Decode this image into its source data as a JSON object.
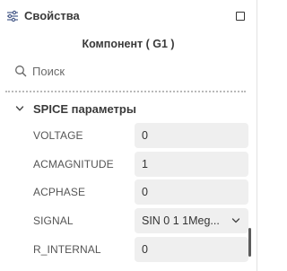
{
  "panel": {
    "title": "Свойства",
    "component_title": "Компонент ( G1 )"
  },
  "search": {
    "placeholder": "Поиск",
    "value": ""
  },
  "section": {
    "title": "SPICE параметры",
    "expanded": true
  },
  "params": [
    {
      "label": "VOLTAGE",
      "value": "0"
    },
    {
      "label": "ACMAGNITUDE",
      "value": "1"
    },
    {
      "label": "ACPHASE",
      "value": "0"
    },
    {
      "label": "SIGNAL",
      "value": "SIN 0 1 1Meg..."
    },
    {
      "label": "R_INTERNAL",
      "value": "0"
    }
  ],
  "icons": {
    "header": "sliders-icon",
    "window": "maximize-icon",
    "search": "search-icon",
    "section": "chevron-down-icon",
    "select": "chevron-down-icon"
  },
  "colors": {
    "field_background": "#efefef",
    "text": "#333333",
    "label": "#555555",
    "scrollbar": "#5c5c5c"
  }
}
